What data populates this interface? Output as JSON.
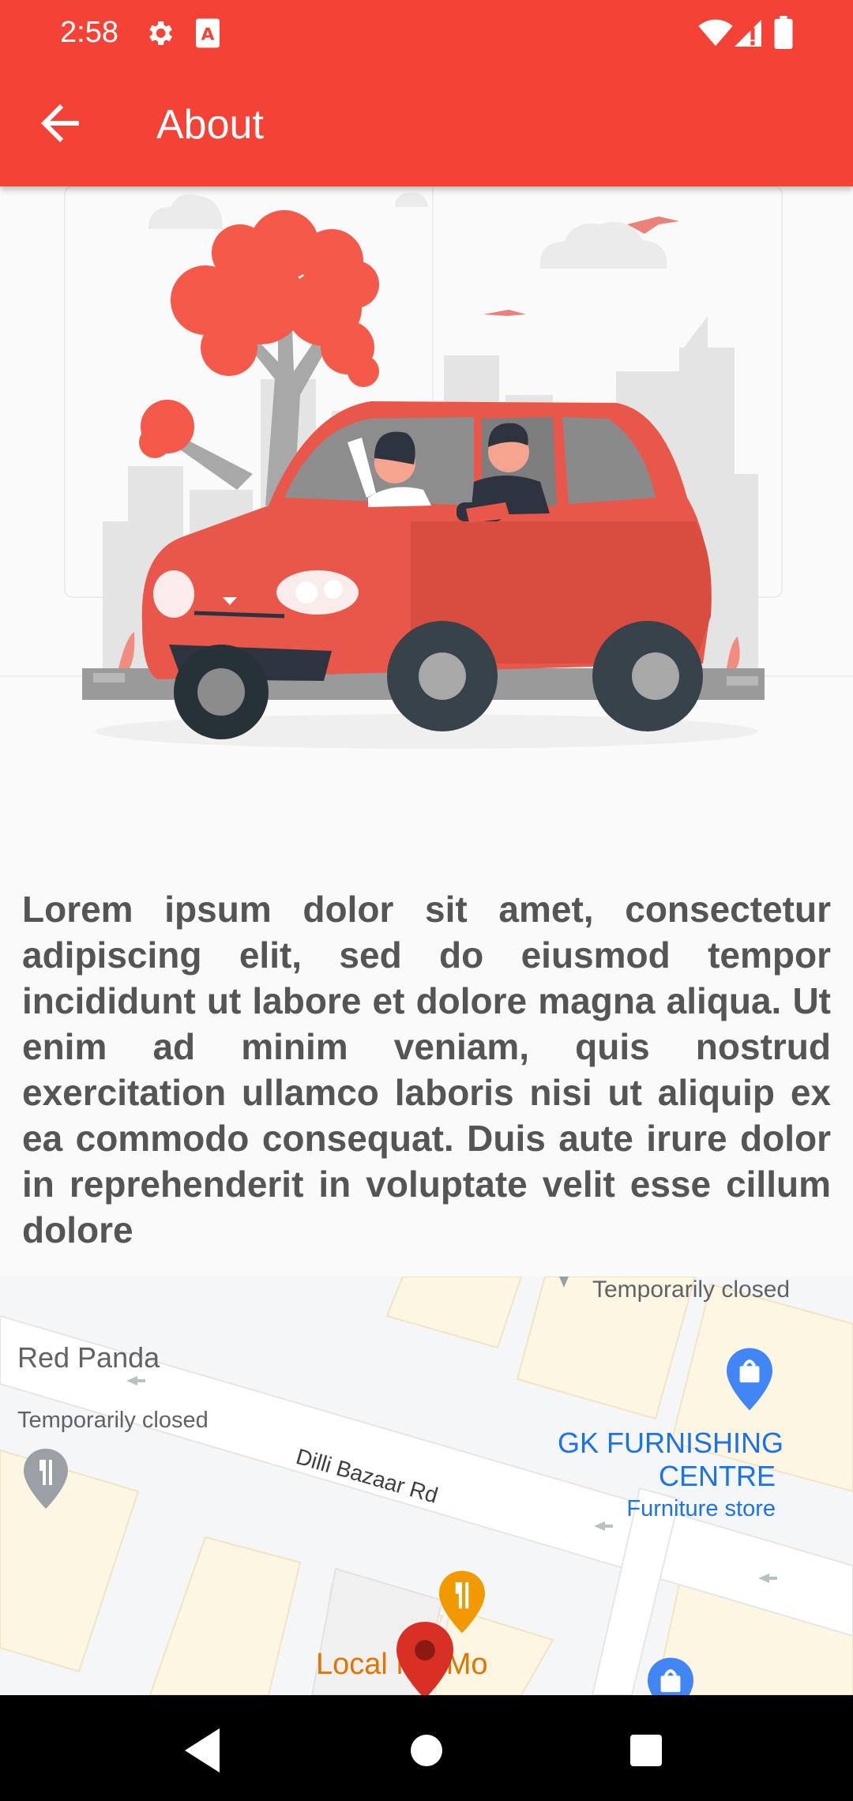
{
  "status_bar": {
    "time": "2:58",
    "icons": [
      "gear-icon",
      "font-a-icon",
      "wifi-icon",
      "signal-icon",
      "battery-icon"
    ]
  },
  "toolbar": {
    "back_icon": "arrow-back-icon",
    "title": "About",
    "color": "#f44336"
  },
  "illustration": {
    "subject": "car-driving-illustration",
    "accent_color": "#f4594a"
  },
  "content": {
    "paragraph": "Lorem ipsum dolor sit amet, consectetur adipiscing elit, sed do eiusmod tempor incididunt ut labore et dolore magna aliqua. Ut enim ad minim veniam, quis nostrud exercitation ullamco laboris nisi ut aliquip ex ea commodo consequat. Duis aute irure dolor in reprehenderit in voluptate velit esse cillum dolore"
  },
  "map": {
    "places": {
      "red_panda": "Red Panda",
      "red_panda_status": "Temporarily closed",
      "top_status": "Temporarily closed",
      "gk_line1": "GK FURNISHING",
      "gk_line2": "CENTRE",
      "gk_category": "Furniture store",
      "local": "Local Mo Mo"
    },
    "road": "Dilli Bazaar Rd",
    "marker_color": "#d93025"
  },
  "nav_bar": {
    "buttons": [
      "back-triangle",
      "home-circle",
      "recents-square"
    ]
  }
}
